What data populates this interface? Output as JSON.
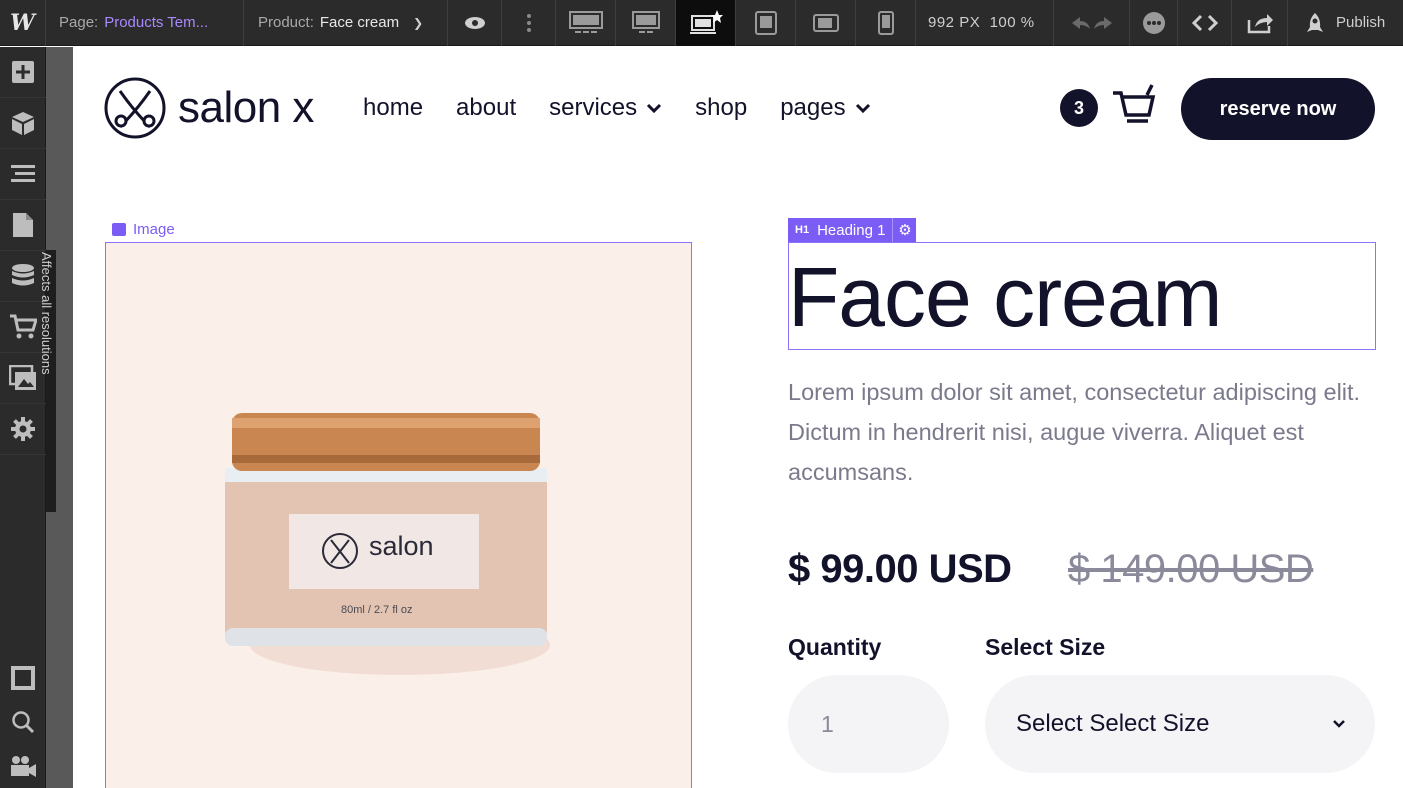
{
  "topbar": {
    "logo": "W",
    "page_label": "Page:",
    "page_value": "Products Tem...",
    "product_label": "Product:",
    "product_value": "Face cream",
    "width": "992 PX",
    "zoom": "100 %",
    "publish": "Publish"
  },
  "sidebar": {
    "vertical_text": "Affects all resolutions",
    "items": [
      "add-icon",
      "components-icon",
      "navigator-icon",
      "pages-icon",
      "cms-icon",
      "ecommerce-icon",
      "assets-icon",
      "settings-icon"
    ],
    "bottom_items": [
      "layout-icon",
      "search-icon",
      "video-icon"
    ]
  },
  "site": {
    "brand": "salon x",
    "nav": [
      "home",
      "about",
      "services",
      "shop",
      "pages"
    ],
    "cart_count": "3",
    "cta": "reserve now"
  },
  "product": {
    "image_tag": "Image",
    "jar_brand": "salon",
    "jar_volume": "80ml / 2.7 fl oz",
    "heading_tag_prefix": "H1",
    "heading_tag": "Heading 1",
    "title": "Face cream",
    "description": "Lorem ipsum dolor sit amet, consectetur adipiscing elit. Dictum in hendrerit nisi, augue viverra. Aliquet est accumsans.",
    "price": "$ 99.00 USD",
    "old_price": "$ 149.00 USD",
    "quantity_label": "Quantity",
    "quantity_value": "1",
    "size_label": "Select Size",
    "size_value": "Select Select Size"
  },
  "colors": {
    "accent": "#7b5cf5",
    "dark": "#12122a",
    "editor_bg": "#2b2b2b"
  }
}
